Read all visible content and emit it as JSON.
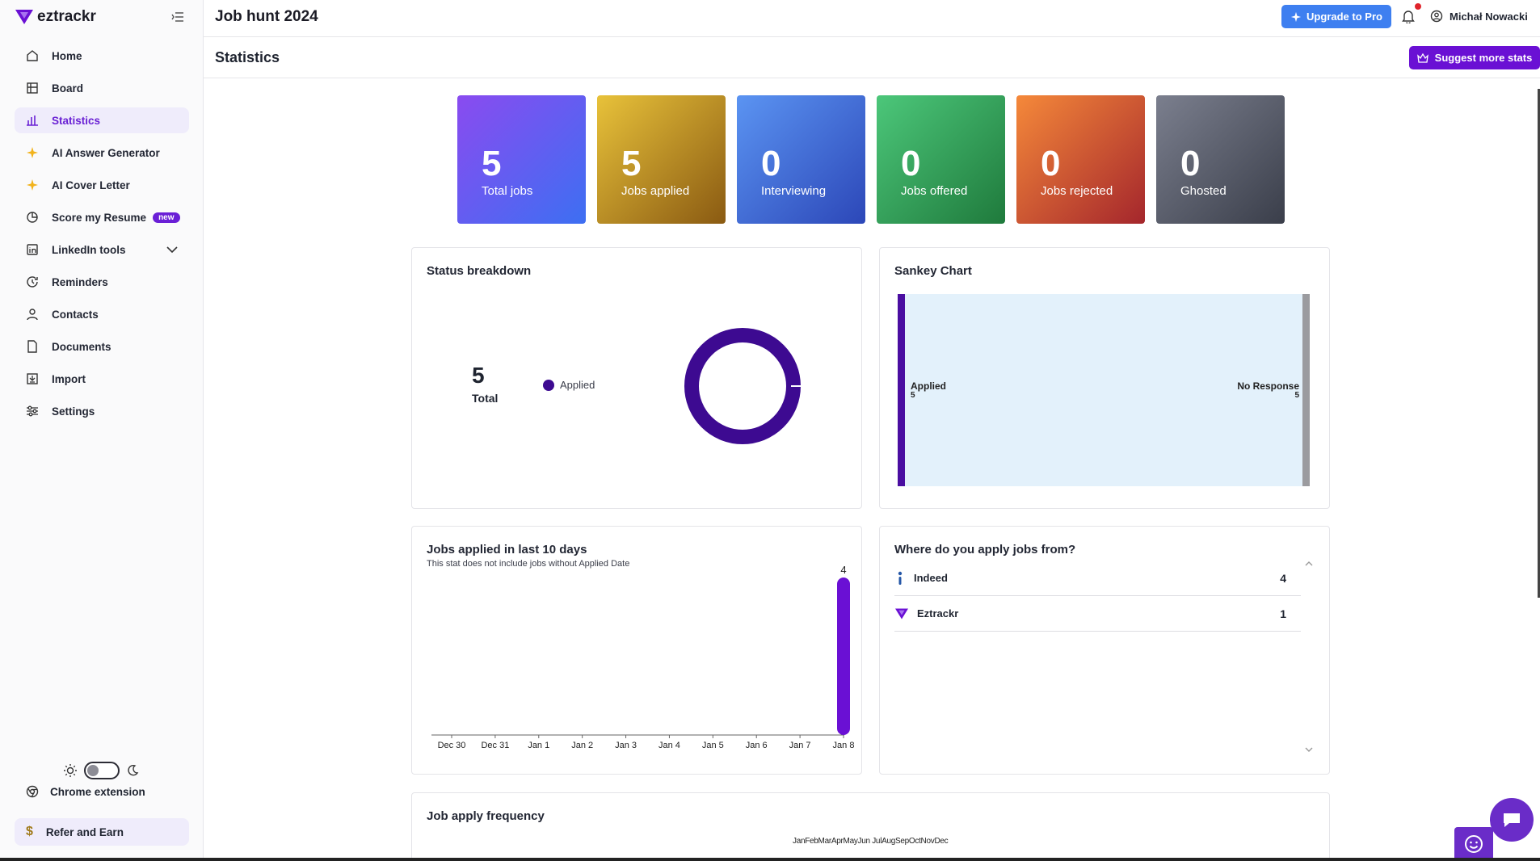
{
  "app": {
    "logo": "eztrackr",
    "board_title": "Job hunt 2024",
    "page_title": "Statistics"
  },
  "sidebar": {
    "items": [
      {
        "label": "Home",
        "icon": "home-icon"
      },
      {
        "label": "Board",
        "icon": "board-icon"
      },
      {
        "label": "Statistics",
        "icon": "bar-chart-icon",
        "active": true
      },
      {
        "label": "AI Answer Generator",
        "icon": "sparkle-icon"
      },
      {
        "label": "AI Cover Letter",
        "icon": "sparkle-icon"
      },
      {
        "label": "Score my Resume",
        "icon": "resume-score-icon",
        "badge": "new"
      },
      {
        "label": "LinkedIn tools",
        "icon": "linkedin-icon"
      },
      {
        "label": "Reminders",
        "icon": "reminder-icon"
      },
      {
        "label": "Contacts",
        "icon": "contact-icon"
      },
      {
        "label": "Documents",
        "icon": "document-icon"
      },
      {
        "label": "Import",
        "icon": "import-icon"
      },
      {
        "label": "Settings",
        "icon": "settings-icon"
      }
    ],
    "chrome_extension": "Chrome extension",
    "refer": "Refer and Earn"
  },
  "topbar": {
    "upgrade": "Upgrade to Pro",
    "user": "Michał Nowacki"
  },
  "subbar": {
    "suggest": "Suggest more stats"
  },
  "stats": [
    {
      "value": "5",
      "label": "Total jobs",
      "from": "#8a4bf0",
      "to": "#3d6ff2"
    },
    {
      "value": "5",
      "label": "Jobs applied",
      "from": "#e8c23a",
      "to": "#8a5a12"
    },
    {
      "value": "0",
      "label": "Interviewing",
      "from": "#5b94f2",
      "to": "#2c47b8"
    },
    {
      "value": "0",
      "label": "Jobs offered",
      "from": "#4cc77a",
      "to": "#1f7a3c"
    },
    {
      "value": "0",
      "label": "Jobs rejected",
      "from": "#f5893a",
      "to": "#a4262c"
    },
    {
      "value": "0",
      "label": "Ghosted",
      "from": "#7b7f8e",
      "to": "#3a3e4a"
    }
  ],
  "status_breakdown": {
    "title": "Status breakdown",
    "total_value": "5",
    "total_label": "Total",
    "legend": "Applied",
    "color": "#3d0a91"
  },
  "sankey": {
    "title": "Sankey Chart",
    "source_label": "Applied",
    "source_value": "5",
    "target_label": "No Response",
    "target_value": "5"
  },
  "applied_chart": {
    "title": "Jobs applied in last 10 days",
    "subtitle": "This stat does not include jobs without Applied Date"
  },
  "chart_data": {
    "type": "bar",
    "categories": [
      "Dec 30",
      "Dec 31",
      "Jan 1",
      "Jan 2",
      "Jan 3",
      "Jan 4",
      "Jan 5",
      "Jan 6",
      "Jan 7",
      "Jan 8"
    ],
    "values": [
      0,
      0,
      0,
      0,
      0,
      0,
      0,
      0,
      0,
      4
    ],
    "color": "#6a10d4"
  },
  "sources": {
    "title": "Where do you apply jobs from?",
    "rows": [
      {
        "name": "Indeed",
        "count": "4",
        "icon": "indeed-icon"
      },
      {
        "name": "Eztrackr",
        "count": "1",
        "icon": "eztrackr-icon"
      }
    ]
  },
  "frequency": {
    "title": "Job apply frequency",
    "months": "JanFebMarAprMayJun JulAugSepOctNovDec"
  }
}
